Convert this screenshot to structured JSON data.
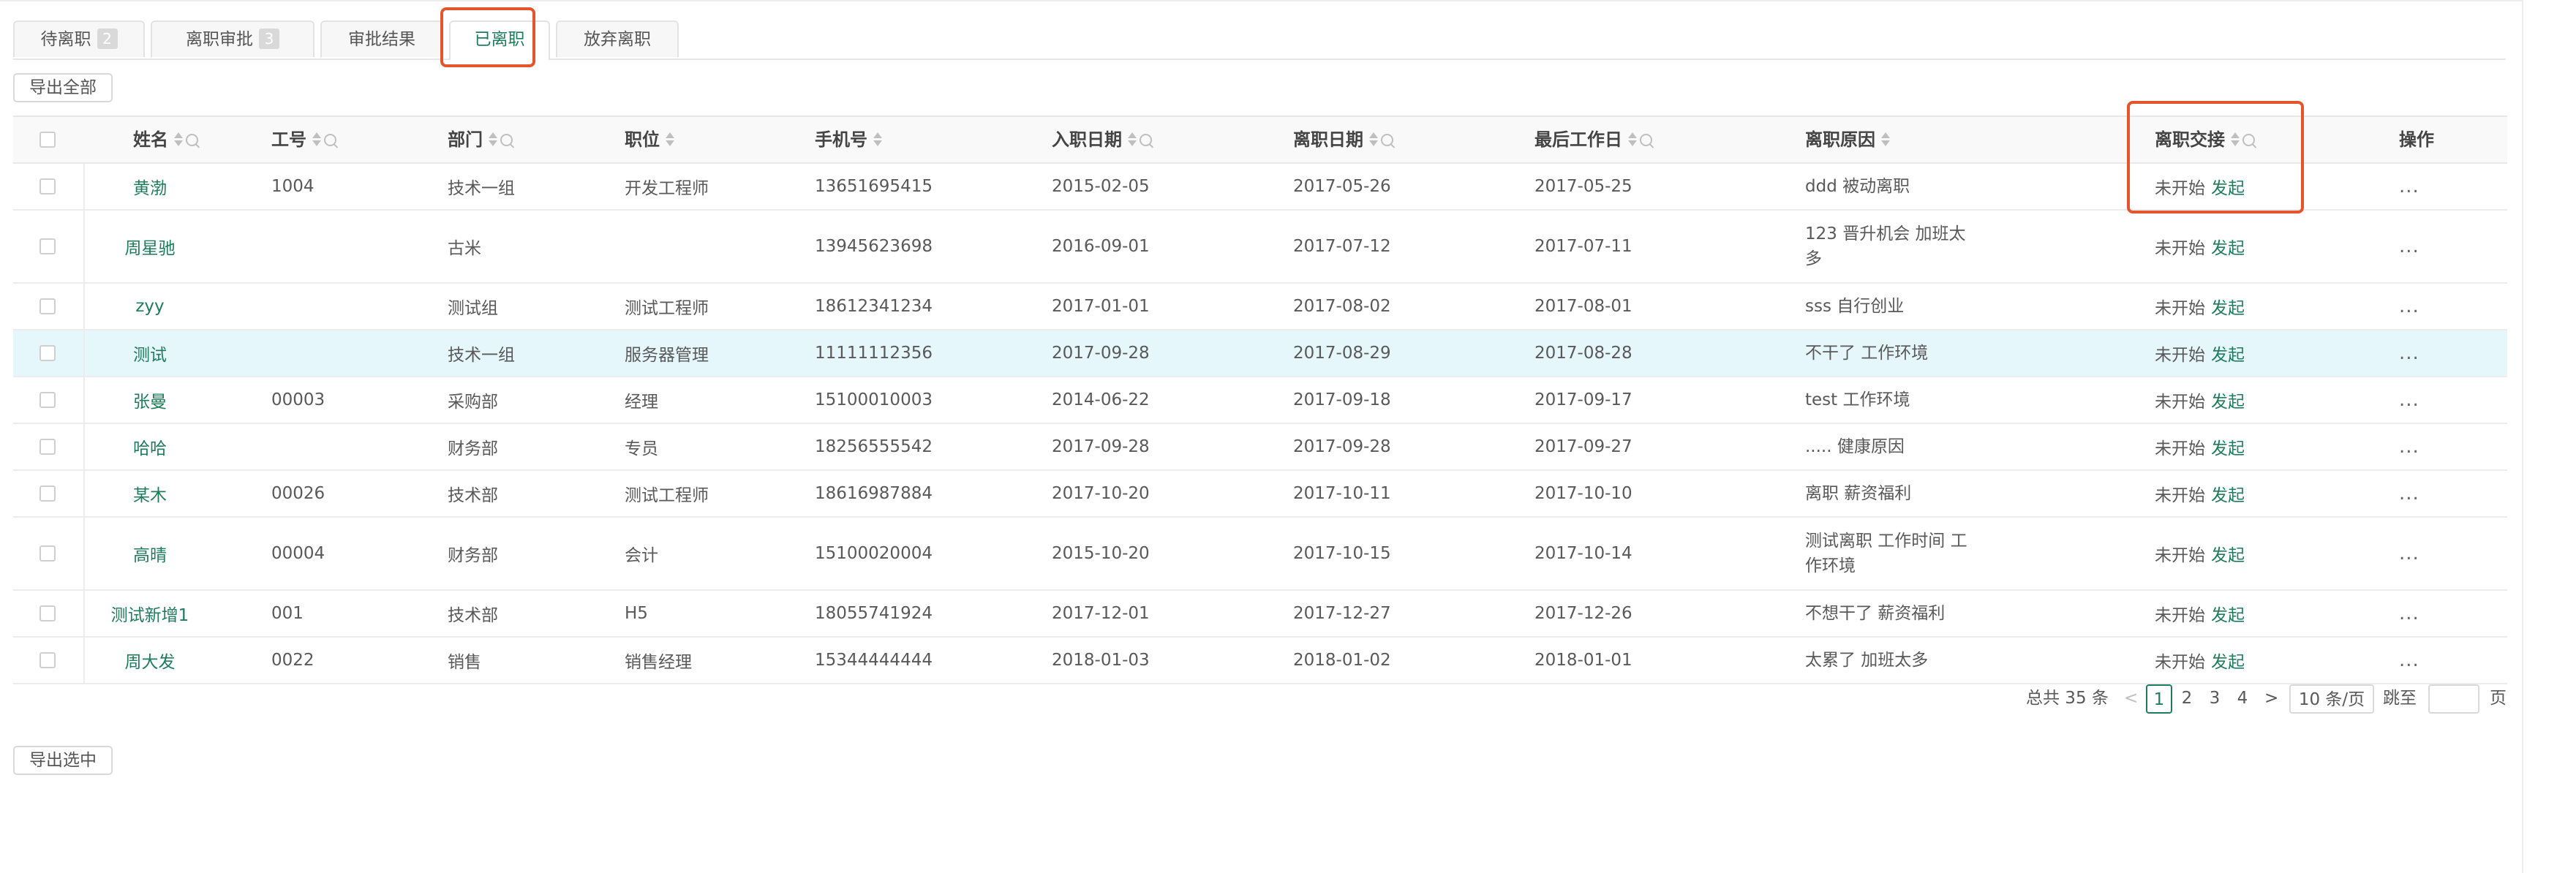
{
  "tabs": [
    {
      "label": "待离职",
      "badge": "2"
    },
    {
      "label": "离职审批",
      "badge": "3"
    },
    {
      "label": "审批结果",
      "badge": ""
    },
    {
      "label": "已离职",
      "badge": ""
    },
    {
      "label": "放弃离职",
      "badge": ""
    }
  ],
  "export_all_label": "导出全部",
  "export_selected_label": "导出选中",
  "columns": {
    "name": "姓名",
    "id": "工号",
    "dept": "部门",
    "position": "职位",
    "phone": "手机号",
    "join": "入职日期",
    "leave": "离职日期",
    "last": "最后工作日",
    "reason": "离职原因",
    "handover": "离职交接",
    "ops": "操作"
  },
  "rows": [
    {
      "name": "黄渤",
      "id": "1004",
      "dept": "技术一组",
      "position": "开发工程师",
      "phone": "13651695415",
      "join": "2015-02-05",
      "leave": "2017-05-26",
      "last": "2017-05-25",
      "reason": "ddd 被动离职",
      "status": "未开始",
      "action": "发起",
      "ops": "..."
    },
    {
      "name": "周星驰",
      "id": "",
      "dept": "古米",
      "position": "",
      "phone": "13945623698",
      "join": "2016-09-01",
      "leave": "2017-07-12",
      "last": "2017-07-11",
      "reason": "123 晋升机会 加班太多",
      "status": "未开始",
      "action": "发起",
      "ops": "..."
    },
    {
      "name": "zyy",
      "id": "",
      "dept": "测试组",
      "position": "测试工程师",
      "phone": "18612341234",
      "join": "2017-01-01",
      "leave": "2017-08-02",
      "last": "2017-08-01",
      "reason": "sss 自行创业",
      "status": "未开始",
      "action": "发起",
      "ops": "..."
    },
    {
      "name": "测试",
      "id": "",
      "dept": "技术一组",
      "position": "服务器管理",
      "phone": "11111112356",
      "join": "2017-09-28",
      "leave": "2017-08-29",
      "last": "2017-08-28",
      "reason": "不干了 工作环境",
      "status": "未开始",
      "action": "发起",
      "ops": "..."
    },
    {
      "name": "张曼",
      "id": "00003",
      "dept": "采购部",
      "position": "经理",
      "phone": "15100010003",
      "join": "2014-06-22",
      "leave": "2017-09-18",
      "last": "2017-09-17",
      "reason": "test 工作环境",
      "status": "未开始",
      "action": "发起",
      "ops": "..."
    },
    {
      "name": "哈哈",
      "id": "",
      "dept": "财务部",
      "position": "专员",
      "phone": "18256555542",
      "join": "2017-09-28",
      "leave": "2017-09-28",
      "last": "2017-09-27",
      "reason": "..... 健康原因",
      "status": "未开始",
      "action": "发起",
      "ops": "..."
    },
    {
      "name": "某木",
      "id": "00026",
      "dept": "技术部",
      "position": "测试工程师",
      "phone": "18616987884",
      "join": "2017-10-20",
      "leave": "2017-10-11",
      "last": "2017-10-10",
      "reason": "离职 薪资福利",
      "status": "未开始",
      "action": "发起",
      "ops": "..."
    },
    {
      "name": "高晴",
      "id": "00004",
      "dept": "财务部",
      "position": "会计",
      "phone": "15100020004",
      "join": "2015-10-20",
      "leave": "2017-10-15",
      "last": "2017-10-14",
      "reason": "测试离职 工作时间 工作环境",
      "status": "未开始",
      "action": "发起",
      "ops": "..."
    },
    {
      "name": "测试新增1",
      "id": "001",
      "dept": "技术部",
      "position": "H5",
      "phone": "18055741924",
      "join": "2017-12-01",
      "leave": "2017-12-27",
      "last": "2017-12-26",
      "reason": "不想干了 薪资福利",
      "status": "未开始",
      "action": "发起",
      "ops": "..."
    },
    {
      "name": "周大发",
      "id": "0022",
      "dept": "销售",
      "position": "销售经理",
      "phone": "15344444444",
      "join": "2018-01-03",
      "leave": "2018-01-02",
      "last": "2018-01-01",
      "reason": "太累了 加班太多",
      "status": "未开始",
      "action": "发起",
      "ops": "..."
    }
  ],
  "pagination": {
    "total": "总共 35 条",
    "prev": "<",
    "pages": [
      "1",
      "2",
      "3",
      "4"
    ],
    "next": ">",
    "page_size": "10 条/页",
    "jump_label": "跳至",
    "page_suffix": "页"
  },
  "colors": {
    "accent": "#1f7d5c",
    "highlight_box": "#e5552d",
    "row_highlight": "#e6f7fc"
  }
}
